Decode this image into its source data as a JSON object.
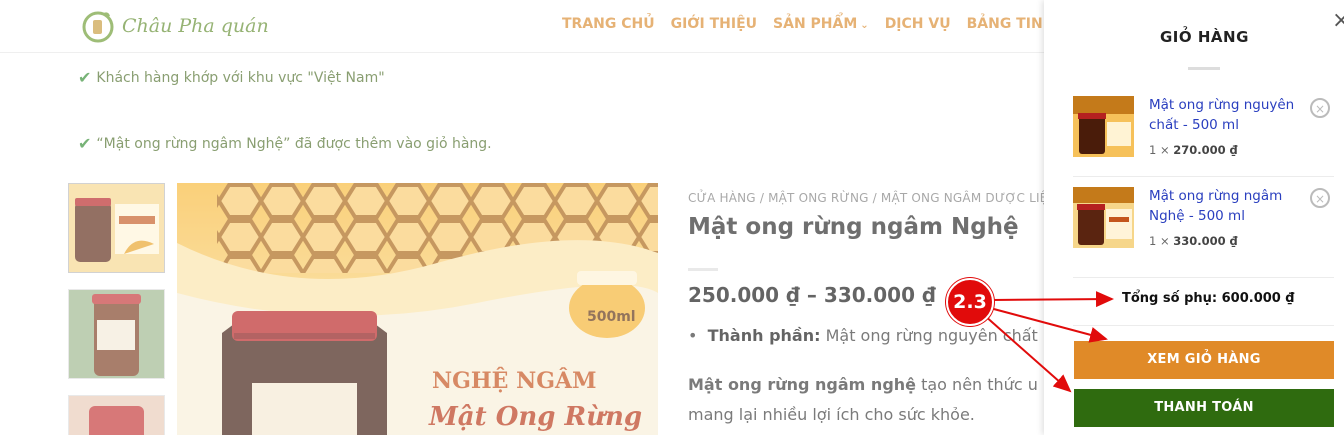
{
  "header": {
    "logo_text": "Châu Pha quán",
    "nav": [
      {
        "label": "TRANG CHỦ",
        "has_dropdown": false
      },
      {
        "label": "GIỚI THIỆU",
        "has_dropdown": false
      },
      {
        "label": "SẢN PHẨM",
        "has_dropdown": true
      },
      {
        "label": "DỊCH VỤ",
        "has_dropdown": false
      },
      {
        "label": "BẢNG TIN",
        "has_dropdown": true
      }
    ]
  },
  "notices": [
    "Khách hàng khớp với khu vực \"Việt Nam\"",
    "“Mật ong rừng ngâm Nghệ” đã được thêm vào giỏ hàng."
  ],
  "gallery": {
    "main_image_texts": [
      "500ml",
      "NGHỆ NGÂM",
      "Mật Ong Rừng"
    ]
  },
  "product": {
    "breadcrumb": "CỬA HÀNG  /  MẬT ONG RỪNG  /  MẬT ONG NGÂM DƯỢC LIỆU",
    "title": "Mật ong rừng ngâm Nghệ",
    "price": "250.000 ₫ – 330.000 ₫",
    "spec_label": "Thành phần:",
    "spec_value": " Mật ong rừng nguyên chất",
    "desc_bold": "Mật ong rừng ngâm nghệ",
    "desc_rest": " tạo nên thức u",
    "desc_line2": "mang lại nhiều lợi ích cho sức khỏe."
  },
  "cart": {
    "title": "GIỎ HÀNG",
    "items": [
      {
        "name": "Mật ong rừng nguyên chất - 500 ml",
        "qty": "1 ×",
        "price": "270.000 ₫"
      },
      {
        "name": "Mật ong rừng ngâm Nghệ - 500 ml",
        "qty": "1 ×",
        "price": "330.000 ₫"
      }
    ],
    "subtotal": "Tổng số phụ: 600.000 ₫",
    "view_cart": "XEM GIỎ HÀNG",
    "checkout": "THANH TOÁN",
    "remove_symbol": "×",
    "close_symbol": "×"
  },
  "annotation": {
    "badge": "2.3",
    "color": "#e10b0b"
  },
  "colors": {
    "nav": "#d9892b",
    "link": "#2a3fbf",
    "view_button": "#e08a28",
    "checkout_button": "#2f6b0f"
  }
}
